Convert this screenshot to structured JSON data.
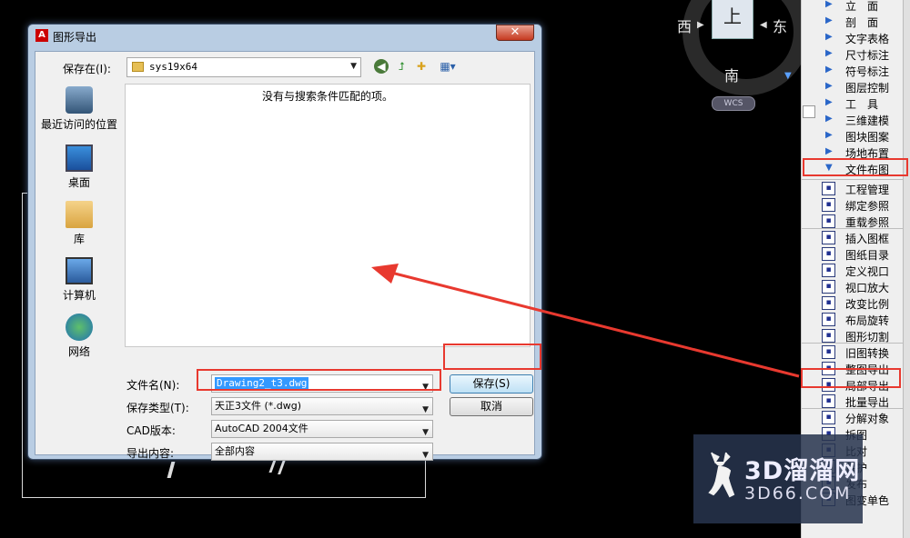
{
  "compass": {
    "north_view": "上",
    "west": "西",
    "east": "东",
    "south": "南",
    "wcs": "WCS"
  },
  "palette": {
    "items": [
      {
        "label": "立　面",
        "kind": "arrow"
      },
      {
        "label": "剖　面",
        "kind": "arrow"
      },
      {
        "label": "文字表格",
        "kind": "arrow"
      },
      {
        "label": "尺寸标注",
        "kind": "arrow"
      },
      {
        "label": "符号标注",
        "kind": "arrow"
      },
      {
        "label": "图层控制",
        "kind": "arrow"
      },
      {
        "label": "工　具",
        "kind": "arrow"
      },
      {
        "label": "三维建模",
        "kind": "arrow"
      },
      {
        "label": "图块图案",
        "kind": "arrow"
      },
      {
        "label": "场地布置",
        "kind": "arrow"
      },
      {
        "label": "文件布图",
        "kind": "expanded"
      },
      {
        "label": "工程管理",
        "kind": "icon"
      },
      {
        "label": "绑定参照",
        "kind": "icon"
      },
      {
        "label": "重载参照",
        "kind": "icon"
      },
      {
        "label": "插入图框",
        "kind": "icon"
      },
      {
        "label": "图纸目录",
        "kind": "icon"
      },
      {
        "label": "定义视口",
        "kind": "icon"
      },
      {
        "label": "视口放大",
        "kind": "icon"
      },
      {
        "label": "改变比例",
        "kind": "icon"
      },
      {
        "label": "布局旋转",
        "kind": "icon"
      },
      {
        "label": "图形切割",
        "kind": "icon"
      },
      {
        "label": "旧图转换",
        "kind": "icon"
      },
      {
        "label": "整图导出",
        "kind": "icon"
      },
      {
        "label": "局部导出",
        "kind": "icon"
      },
      {
        "label": "批量导出",
        "kind": "icon"
      },
      {
        "label": "分解对象",
        "kind": "icon"
      },
      {
        "label": "拆图",
        "kind": "icon"
      },
      {
        "label": "比对",
        "kind": "icon"
      },
      {
        "label": "保护",
        "kind": "icon"
      },
      {
        "label": "发布",
        "kind": "icon"
      },
      {
        "label": "图变单色",
        "kind": "icon"
      }
    ]
  },
  "watermark": {
    "brand": "3D溜溜网",
    "domain": "3D66.COM"
  },
  "dialog": {
    "title": "图形导出",
    "close_glyph": "✕",
    "save_in_label": "保存在(I):",
    "save_in_value": "sys19x64",
    "places": [
      "最近访问的位置",
      "桌面",
      "库",
      "计算机",
      "网络"
    ],
    "empty_message": "没有与搜索条件匹配的项。",
    "filename_label": "文件名(N):",
    "filename_value": "Drawing2_t3.dwg",
    "filetype_label": "保存类型(T):",
    "filetype_value": "天正3文件 (*.dwg)",
    "cad_version_label": "CAD版本:",
    "cad_version_value": "AutoCAD 2004文件",
    "export_content_label": "导出内容:",
    "export_content_value": "全部内容",
    "save_button": "保存(S)",
    "cancel_button": "取消"
  },
  "colors": {
    "highlight_red": "#e8392f",
    "accent_blue": "#3399ff"
  }
}
